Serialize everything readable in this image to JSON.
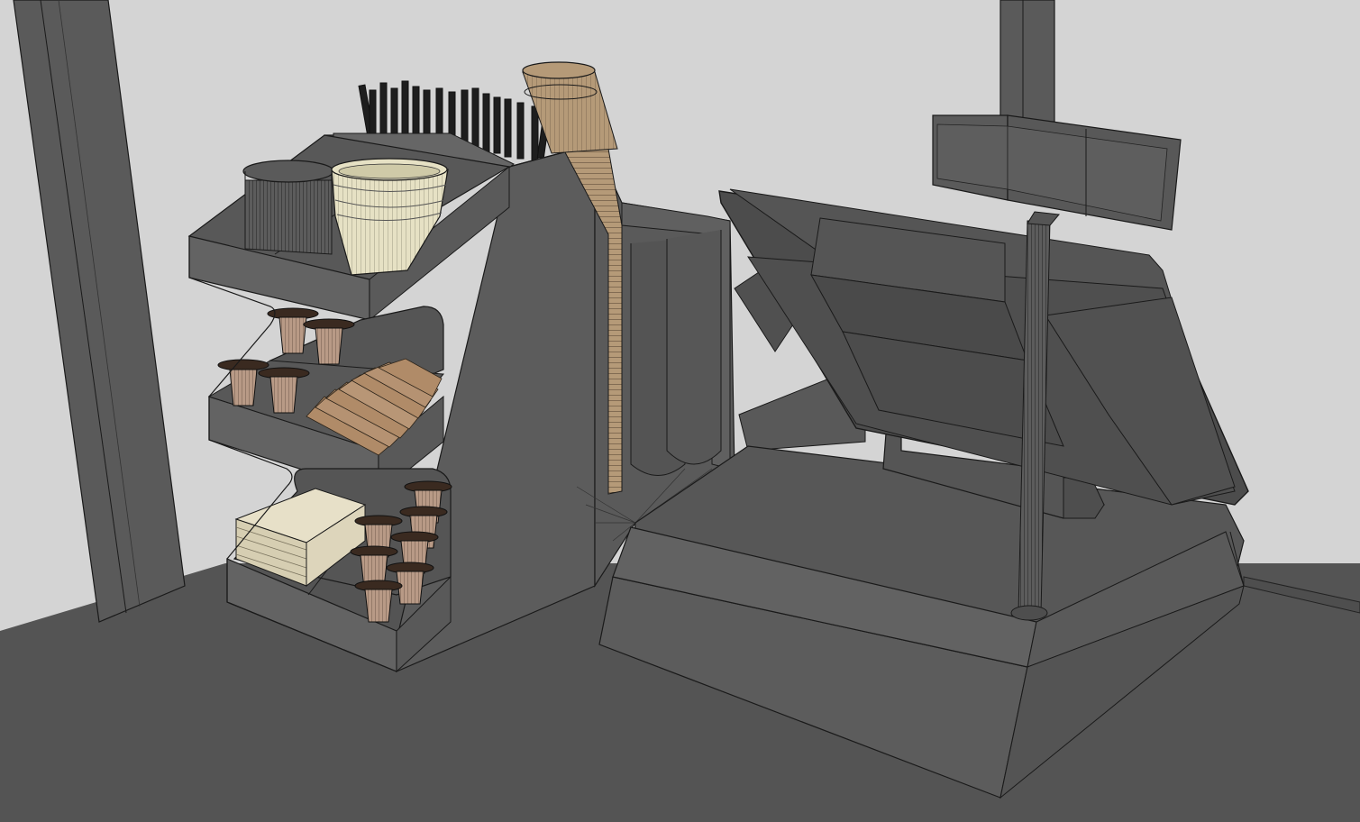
{
  "scene": {
    "description_visible_text": "",
    "colors": {
      "background_wall": "#d4d4d4",
      "floor": "#545454",
      "organizer_body": "#5a5a5a",
      "wire_edge": "#1a1a1a",
      "cup_paper": "#e6e1c4",
      "cup_kraft": "#b59a78",
      "creamer": "#b89a86",
      "straws": "#1e1e1e",
      "pos_body": "#585858",
      "pos_screen": "#4a4a4a"
    }
  }
}
